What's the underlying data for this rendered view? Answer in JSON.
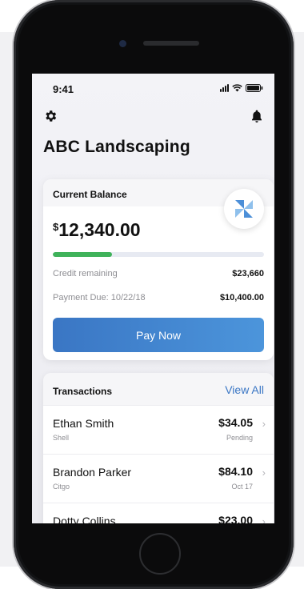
{
  "status_bar": {
    "time": "9:41"
  },
  "header": {
    "title": "ABC Landscaping"
  },
  "balance_card": {
    "label": "Current Balance",
    "currency_symbol": "$",
    "amount": "12,340.00",
    "credit_progress": 0.28,
    "credit_label": "Credit remaining",
    "credit_value": "$23,660",
    "payment_due_label": "Payment Due: 10/22/18",
    "payment_due_value": "$10,400.00",
    "pay_button": "Pay Now"
  },
  "transactions": {
    "title": "Transactions",
    "view_all": "View All",
    "items": [
      {
        "name": "Ethan Smith",
        "merchant": "Shell",
        "amount": "$34.05",
        "status": "Pending"
      },
      {
        "name": "Brandon Parker",
        "merchant": "Citgo",
        "amount": "$84.10",
        "status": "Oct 17"
      },
      {
        "name": "Dotty Collins",
        "merchant": "",
        "amount": "$23.00",
        "status": ""
      }
    ]
  },
  "colors": {
    "accent": "#3a76c4",
    "progress": "#3fb25a",
    "logo_blue": "#4c8fd8"
  },
  "icons": {
    "settings": "gear-icon",
    "notifications": "bell-icon",
    "company_logo": "pinwheel-logo-icon",
    "chevron": "chevron-right-icon"
  }
}
